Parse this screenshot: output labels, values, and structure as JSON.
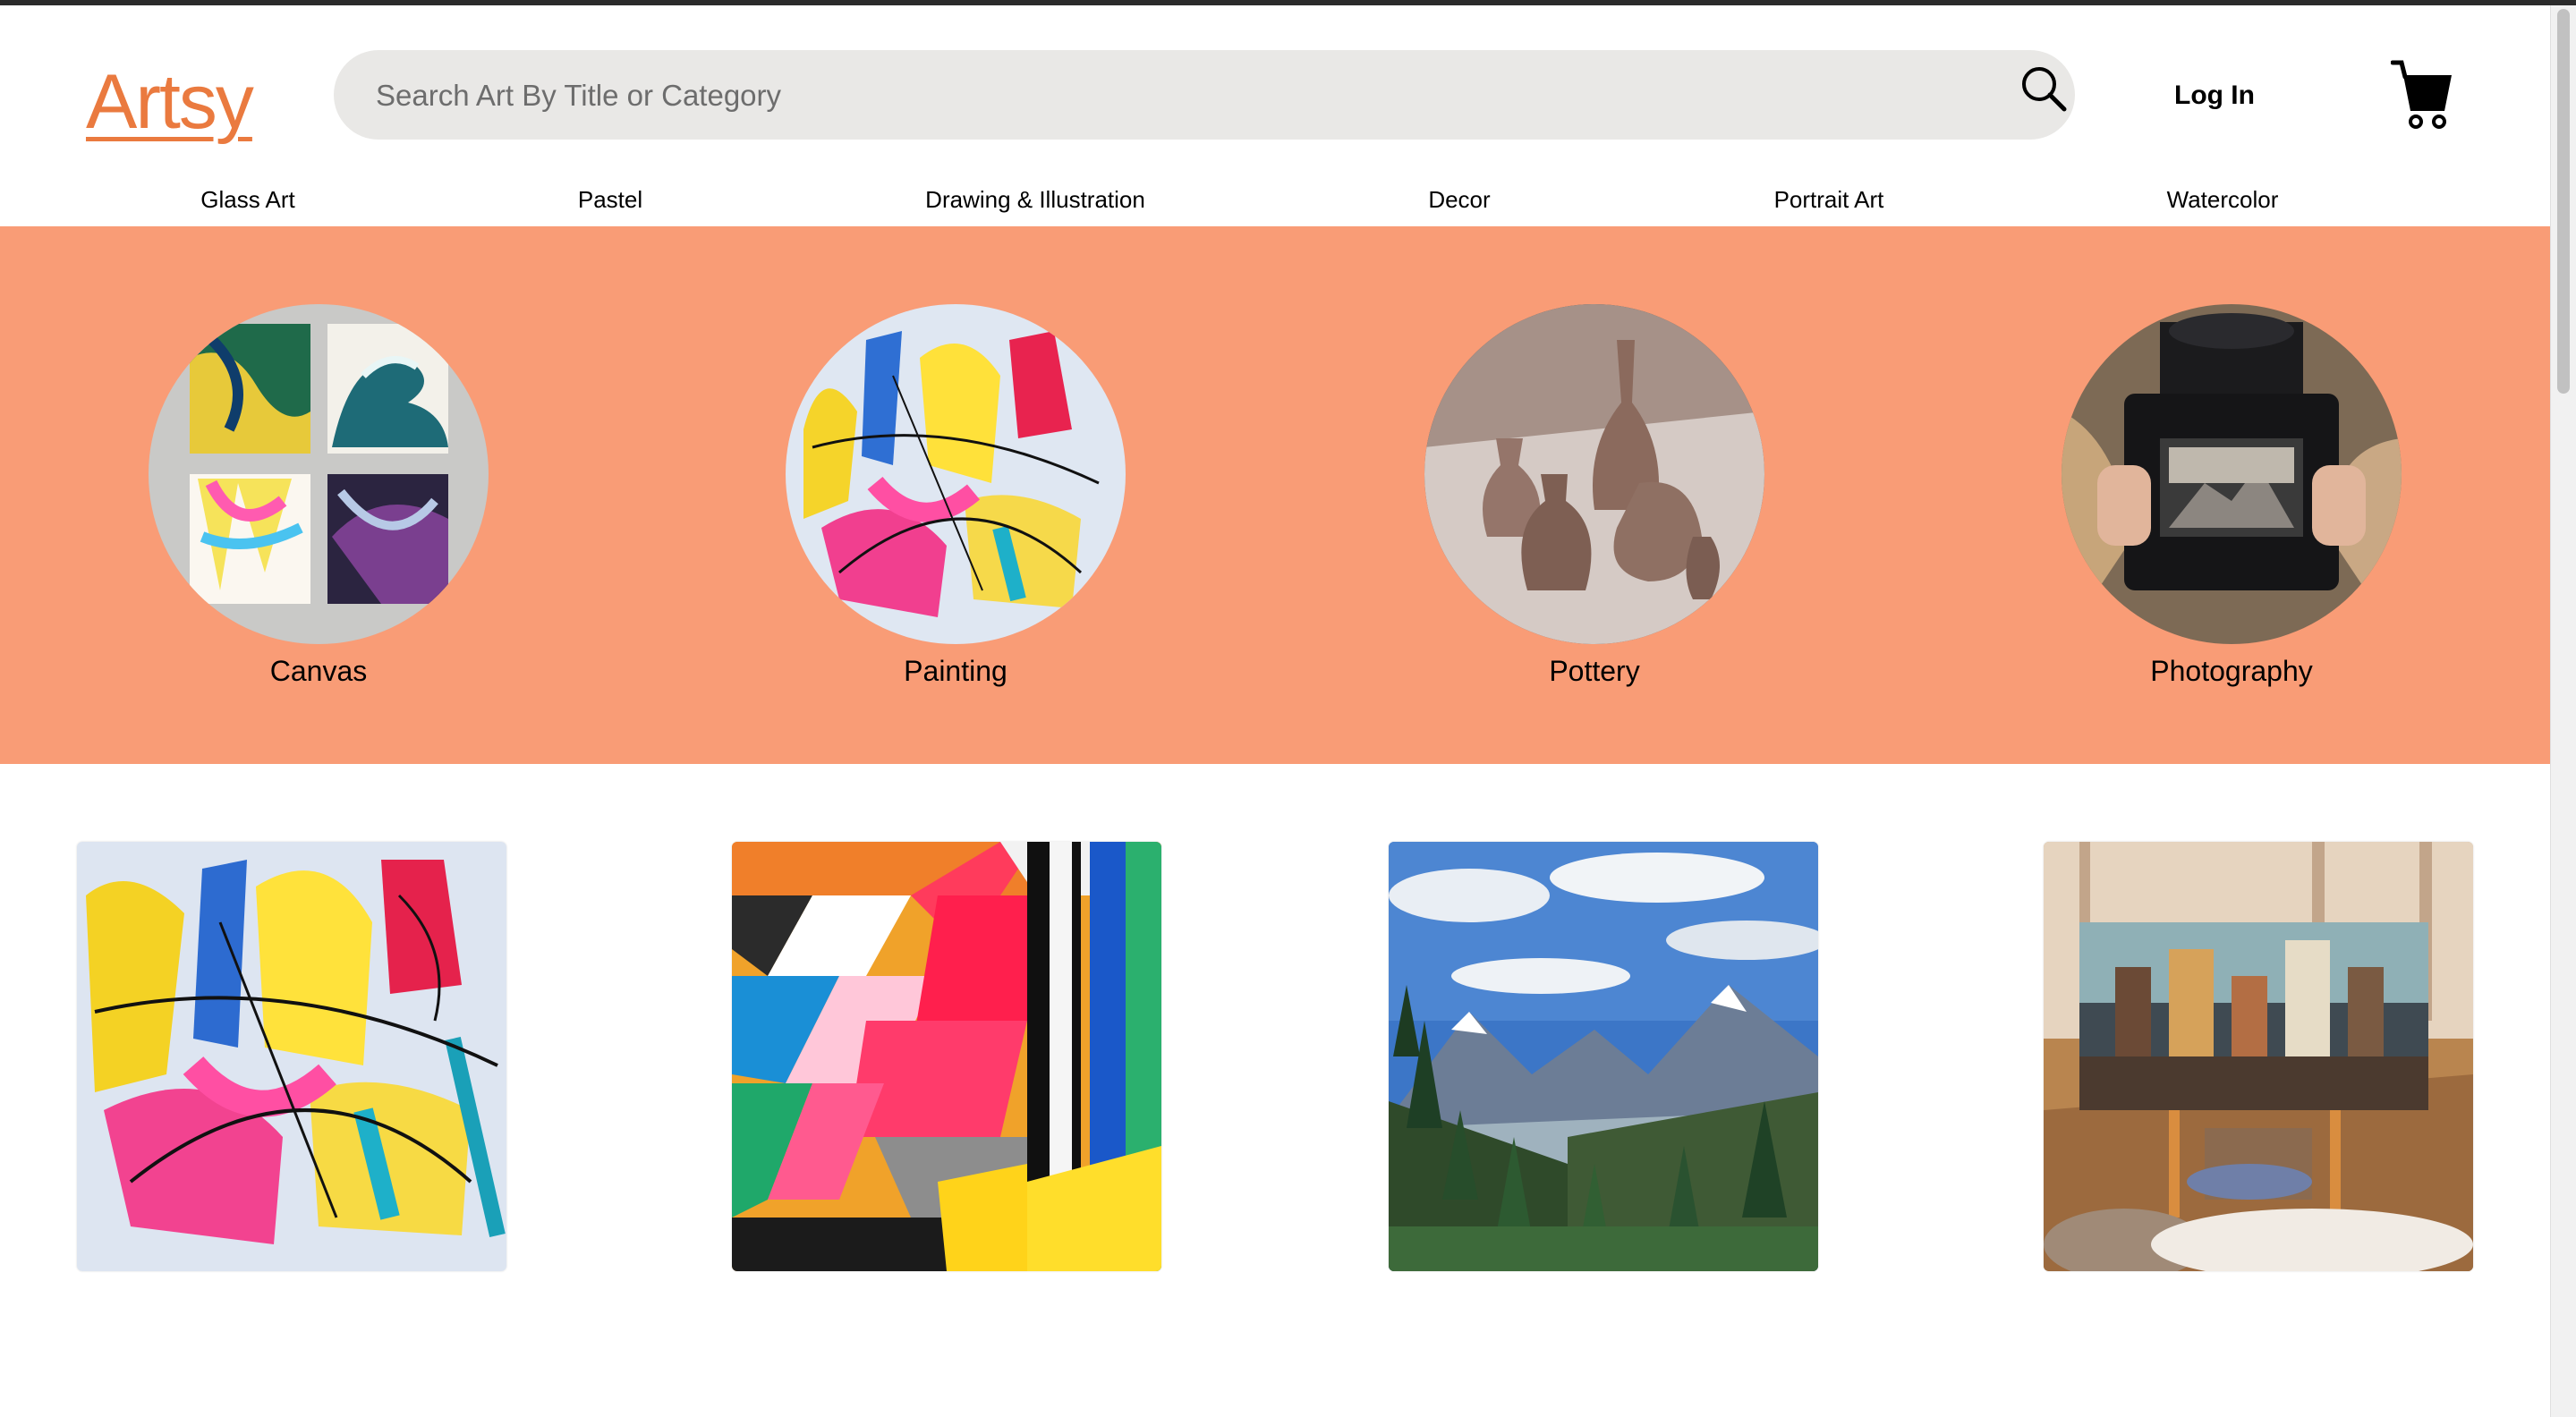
{
  "header": {
    "logo_text": "Artsy",
    "search_placeholder": "Search Art By Title or Category",
    "login_label": "Log In",
    "search_icon": "search-icon",
    "cart_icon": "shopping-cart-icon"
  },
  "nav": {
    "items": [
      "Glass Art",
      "Pastel",
      "Drawing & Illustration",
      "Decor",
      "Portrait Art",
      "Watercolor"
    ]
  },
  "categories": [
    {
      "label": "Canvas"
    },
    {
      "label": "Painting"
    },
    {
      "label": "Pottery"
    },
    {
      "label": "Photography"
    }
  ],
  "colors": {
    "accent": "#ea7a3f",
    "band": "#f99c76",
    "search_bg": "#e9e8e6"
  }
}
